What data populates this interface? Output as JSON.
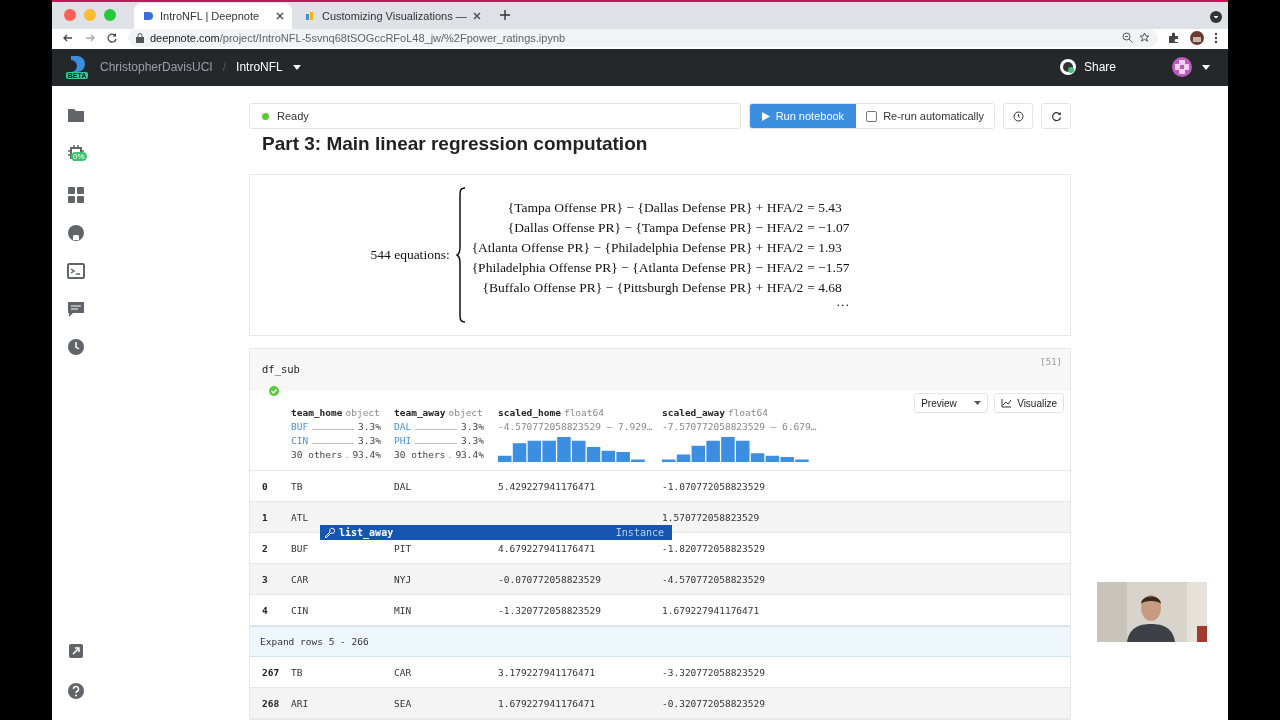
{
  "browser": {
    "tabs": [
      {
        "title": "IntroNFL | Deepnote",
        "selected": true
      },
      {
        "title": "Customizing Visualizations —",
        "selected": false
      }
    ],
    "url_host": "deepnote.com",
    "url_path": "/project/IntroNFL-5svnq68tSOGccRFoL48_jw/%2Fpower_ratings.ipynb"
  },
  "header": {
    "workspace": "ChristopherDavisUCI",
    "separator": "/",
    "project": "IntroNFL",
    "badge": "BETA",
    "share": "Share"
  },
  "sidebar": {
    "badge": "0%"
  },
  "toolbar": {
    "status": "Ready",
    "run_button": "Run notebook",
    "rerun": {
      "label": "Re-run automatically",
      "checked": false
    }
  },
  "heading": "Part 3: Main linear regression computation",
  "math": {
    "label": "544 equations:",
    "equations": [
      {
        "lhs": "{Tampa Offense PR} − {Dallas Defense PR} + HFA/2",
        "rhs": "= 5.43"
      },
      {
        "lhs": "{Dallas Offense PR} − {Tampa Defense PR} − HFA/2",
        "rhs": "= −1.07"
      },
      {
        "lhs": "{Atlanta Offense PR} − {Philadelphia Defense PR} + HFA/2",
        "rhs": "= 1.93"
      },
      {
        "lhs": "{Philadelphia Offense PR} − {Atlanta Defense PR} − HFA/2",
        "rhs": "= −1.57"
      },
      {
        "lhs": "{Buffalo Offense PR} − {Pittsburgh Defense PR} + HFA/2",
        "rhs": "= 4.68"
      }
    ],
    "ellipsis": "···"
  },
  "cell": {
    "code": "df_sub",
    "count": "[51]",
    "preview": "Preview",
    "visualize": "Visualize"
  },
  "table": {
    "columns": [
      {
        "kind": "category",
        "name": "team_home",
        "dtype": "object",
        "values": [
          {
            "kind": "top",
            "label": "BUF",
            "pct": "3.3%"
          },
          {
            "kind": "top",
            "label": "CIN",
            "pct": "3.3%"
          },
          {
            "kind": "other",
            "label": "30 others",
            "pct": "93.4%"
          }
        ]
      },
      {
        "kind": "category",
        "name": "team_away",
        "dtype": "object",
        "values": [
          {
            "kind": "top",
            "label": "DAL",
            "pct": "3.3%"
          },
          {
            "kind": "top",
            "label": "PHI",
            "pct": "3.3%"
          },
          {
            "kind": "other",
            "label": "30 others",
            "pct": "93.4%"
          }
        ]
      },
      {
        "kind": "numeric",
        "name": "scaled_home",
        "dtype": "float64",
        "range": "-4.570772058823529 – 7.929…"
      },
      {
        "kind": "numeric",
        "name": "scaled_away",
        "dtype": "float64",
        "range": "-7.570772058823529 – 6.679…"
      }
    ],
    "rows": [
      {
        "kind": "row",
        "index": "0",
        "team_home": "TB",
        "team_away": "DAL",
        "scaled_home": "5.429227941176471",
        "scaled_away": "-1.070772058823529"
      },
      {
        "kind": "row",
        "index": "1",
        "team_home": "ATL",
        "scaled_away": "1.570772058823529"
      },
      {
        "kind": "row",
        "index": "2",
        "team_home": "BUF",
        "team_away": "PIT",
        "scaled_home": "4.679227941176471",
        "scaled_away": "-1.820772058823529"
      },
      {
        "kind": "row",
        "index": "3",
        "team_home": "CAR",
        "team_away": "NYJ",
        "scaled_home": "-0.070772058823529",
        "scaled_away": "-4.570772058823529"
      },
      {
        "kind": "row",
        "index": "4",
        "team_home": "CIN",
        "team_away": "MIN",
        "scaled_home": "-1.320772058823529",
        "scaled_away": "1.679227941176471"
      },
      {
        "kind": "expand",
        "label": "Expand rows 5 - 266"
      },
      {
        "kind": "row",
        "index": "267",
        "team_home": "TB",
        "team_away": "CAR",
        "scaled_home": "3.179227941176471",
        "scaled_away": "-3.320772058823529"
      },
      {
        "kind": "row",
        "index": "268",
        "team_home": "ARI",
        "team_away": "SEA",
        "scaled_home": "1.679227941176471",
        "scaled_away": "-0.320772058823529"
      }
    ]
  },
  "autocomplete": {
    "label": "list_away",
    "type": "Instance"
  }
}
